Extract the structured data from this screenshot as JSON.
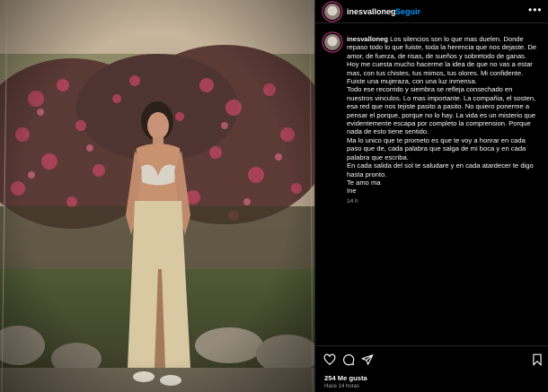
{
  "header": {
    "username": "inesvalloneg",
    "separator": "•",
    "follow_label": "Seguir",
    "more_label": "•••"
  },
  "caption": {
    "username": "inesvalloneg",
    "paragraphs": [
      "Los silencios son lo que mas duelen. Donde repaso todo lo que fuiste, toda la herencia que nos dejaste. De amor, de fuerza, de risas, de sueños y sobretodo de ganas. Hoy me cuesta mucho hacerme la idea de que no vas a estar mas, con tus chistes, tus mimos, tus olores. Mi confidente. Fuiste una mujeraza, con una luz inmensa.",
      "Todo ese recorrido y siembra se refleja consechado en nuestros vinculos. Lo mas importante. La compañia, el sosten, esa red que nos tejiste pasito a pasito. No quiero ponerme a pensar el porque, porque no lo hay. La vida es un misterio que evidentemente escapa por completo la comprension. Porque nada de esto tiene sentido.",
      "Ma lo unico que te prometo es que te voy a honrar en cada paso que de, cada palabra que salga de mi boca y en cada palabra que escriba.",
      "En cada salida del sol te saludare y en cada atardecer te digo hasta pronto.",
      "Te amo ma",
      "Ine"
    ],
    "time": "14 h"
  },
  "actions": {
    "likes": "254 Me gusta",
    "time": "Hace 14 horas"
  },
  "icons": {
    "like": "heart-icon",
    "comment": "comment-icon",
    "share": "share-icon",
    "save": "bookmark-icon",
    "more": "more-dots-icon"
  },
  "colors": {
    "background": "#000000",
    "text": "#f5f5f5",
    "muted": "#a8a8a8",
    "link": "#0095f6",
    "divider": "#262626",
    "story_ring": "#c13584"
  }
}
